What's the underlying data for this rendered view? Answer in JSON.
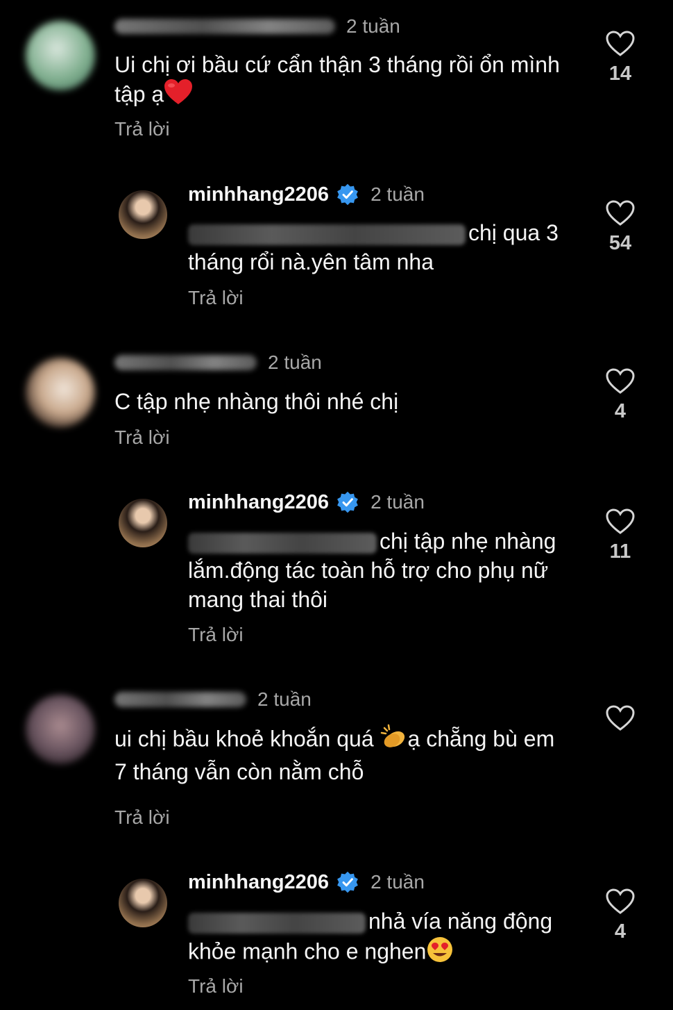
{
  "comments": [
    {
      "time": "2 tuần",
      "text": "Ui chị ơi bầu cứ cẩn thận 3 tháng rồi ổn mình tập ạ",
      "reply_label": "Trả lời",
      "likes": "14",
      "avatar_color": "#7fae8e",
      "emoji": "red-heart",
      "reply": {
        "username": "minhhang2206",
        "time": "2 tuần",
        "text": "chị qua 3 tháng rổi nà.yên tâm nha",
        "reply_label": "Trả lời",
        "likes": "54"
      }
    },
    {
      "time": "2 tuần",
      "text": "C tập nhẹ nhàng thôi nhé chị",
      "reply_label": "Trả lời",
      "likes": "4",
      "avatar_color": "#c9a98d",
      "reply": {
        "username": "minhhang2206",
        "time": "2 tuần",
        "text": "chị tập nhẹ nhàng lắm.động tác toàn hỗ trợ cho phụ nữ mang thai thôi",
        "reply_label": "Trả lời",
        "likes": "11"
      }
    },
    {
      "time": "2 tuần",
      "text": "ui chị bầu khoẻ khoắn quá",
      "text_after_emoji": "ạ chẵng bù em 7 tháng vẫn còn nằm chỗ",
      "reply_label": "Trả lời",
      "likes": "",
      "avatar_color": "#6a5560",
      "emoji": "clapping-hands",
      "reply": {
        "username": "minhhang2206",
        "time": "2 tuần",
        "text": "nhả vía năng động khỏe mạnh cho e nghen",
        "reply_label": "Trả lời",
        "likes": "4",
        "emoji": "heart-eyes"
      }
    }
  ],
  "colors": {
    "background": "#000000",
    "text": "#f5f5f5",
    "secondary": "#a8a8a8",
    "verified": "#3797f0"
  },
  "icons": [
    "heart-outline-icon",
    "verified-badge-icon"
  ]
}
